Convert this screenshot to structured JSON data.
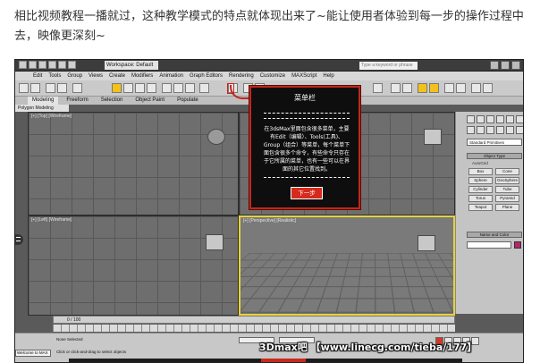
{
  "caption": "相比视频教程一播就过，这种教学模式的特点就体现出来了~能让使用者体验到每一步的操作过程中去，映像更深刻~",
  "titlebar": {
    "workspace": "Workspace: Default",
    "search_placeholder": "Type a keyword or phrase"
  },
  "menubar": {
    "items": [
      "Edit",
      "Tools",
      "Group",
      "Views",
      "Create",
      "Modifiers",
      "Animation",
      "Graph Editors",
      "Rendering",
      "Customize",
      "MAXScript",
      "Help"
    ]
  },
  "ribbon": {
    "tabs": [
      "Modeling",
      "Freeform",
      "Selection",
      "Object Paint",
      "Populate"
    ],
    "active_tab": "Modeling",
    "panel_label": "Polygon Modeling"
  },
  "viewports": {
    "top_left": "[+] [Top] [Wireframe]",
    "bottom_left": "[+] [Left] [Wireframe]",
    "bottom_right": "[+] [Perspective] [Realistic]"
  },
  "command_panel": {
    "dropdown": "Standard Primitives",
    "object_type_header": "Object Type",
    "autogrid": "AutoGrid",
    "objects": [
      "Box",
      "Cone",
      "Sphere",
      "GeoSphere",
      "Cylinder",
      "Tube",
      "Torus",
      "Pyramid",
      "Teapot",
      "Plane"
    ],
    "name_color_header": "Name and Color",
    "color": "#b8246a"
  },
  "timeline": {
    "frame_label": "0 / 100"
  },
  "status": {
    "welcome": "Welcome to MAX",
    "selection": "None Selected",
    "prompt": "Click or click-and-drag to select objects"
  },
  "popup": {
    "title": "菜单栏",
    "body": "在3dsMax里面包含很多菜单，主要有Edit（编辑）、Tools(工具)、Group（组合）等菜单，每个菜单下面包含很多个命令，有些命令只存在于它所属的菜单，也有一些可以在界面的其它位置找到。",
    "next_button": "下一步"
  },
  "watermark": "3Dmax吧  【www.linecg.com/tieba/177】",
  "colors": {
    "popup_border": "#c0271c",
    "next_button": "#d62a1c",
    "active_viewport_border": "#e6d23c"
  }
}
